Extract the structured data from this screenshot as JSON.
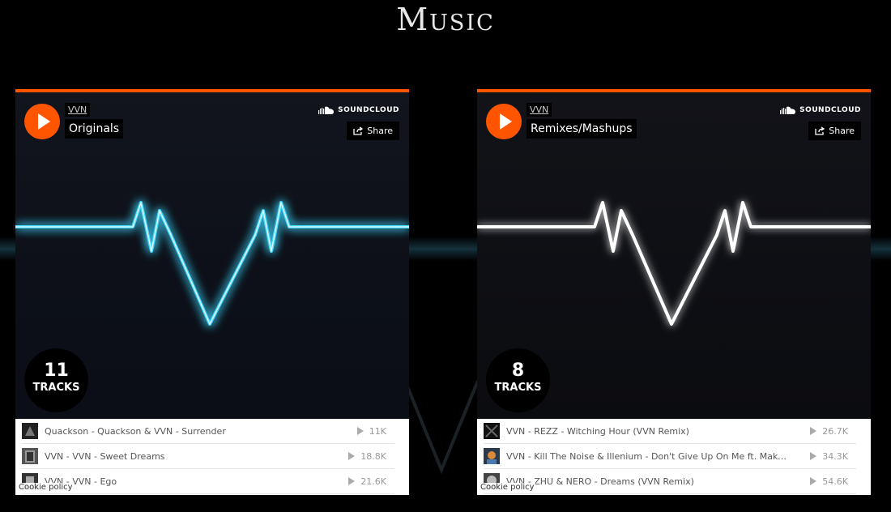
{
  "page": {
    "title": "Music"
  },
  "colors": {
    "accent": "#ff5500",
    "wave_left": "#3fd8ff",
    "wave_right": "#ffffff"
  },
  "players": [
    {
      "artist": "VVN",
      "title": "Originals",
      "brand": "SOUNDCLOUD",
      "share_label": "Share",
      "track_count": "11",
      "track_count_label": "TRACKS",
      "cookie_label": "Cookie policy",
      "tracks": [
        {
          "title": "Quackson - Quackson & VVN - Surrender",
          "plays": "11K"
        },
        {
          "title": "VVN - VVN - Sweet Dreams",
          "plays": "18.8K"
        },
        {
          "title": "VVN - VVN - Ego",
          "plays": "21.6K"
        }
      ]
    },
    {
      "artist": "VVN",
      "title": "Remixes/Mashups",
      "brand": "SOUNDCLOUD",
      "share_label": "Share",
      "track_count": "8",
      "track_count_label": "TRACKS",
      "cookie_label": "Cookie policy",
      "tracks": [
        {
          "title": "VVN - REZZ - Witching Hour (VVN Remix)",
          "plays": "26.7K"
        },
        {
          "title": "VVN - Kill The Noise & Illenium - Don't Give Up On Me ft. Mako (VVN Remix)",
          "plays": "34.3K"
        },
        {
          "title": "VVN - ZHU & NERO - Dreams (VVN Remix)",
          "plays": "54.6K"
        }
      ]
    }
  ]
}
